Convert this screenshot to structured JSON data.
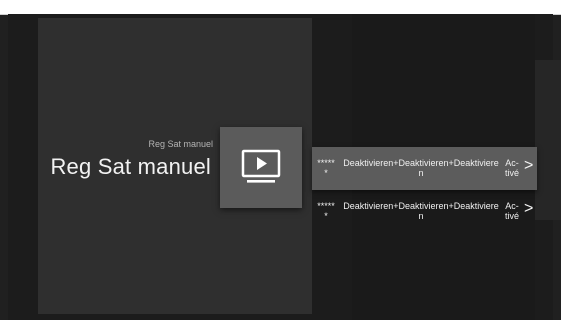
{
  "header": {
    "subtitle": "Reg Sat manuel",
    "title": "Reg Sat manuel"
  },
  "tile": {
    "icon": "tv-play-icon"
  },
  "rows": [
    {
      "stars_line1": "*****",
      "stars_line2": "*",
      "text_line1": "Deaktivieren+Deaktivieren+Deaktiviere",
      "text_line2": "n",
      "active_line1": "Ac-",
      "active_line2": "tivé",
      "selected": true
    },
    {
      "stars_line1": "*****",
      "stars_line2": "*",
      "text_line1": "Deaktivieren+Deaktivieren+Deaktiviere",
      "text_line2": "n",
      "active_line1": "Ac-",
      "active_line2": "tivé",
      "selected": false
    }
  ],
  "colors": {
    "panel": "#2f2f2f",
    "tile": "#5b5b5b",
    "selected_row": "#5c5c5c",
    "background": "#1c1c1c"
  }
}
